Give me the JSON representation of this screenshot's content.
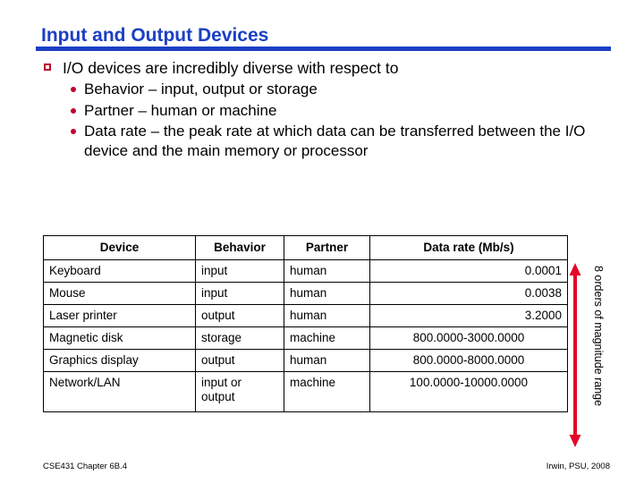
{
  "slide": {
    "title": "Input and Output Devices",
    "accent_color": "#1B3FC4",
    "bullet_color": "#C00030"
  },
  "bullets": {
    "level1": "I/O devices are incredibly diverse with respect to",
    "level2": [
      "Behavior – input, output or storage",
      "Partner – human or machine",
      "Data rate – the peak rate at which data can be transferred between the I/O device and the main memory or processor"
    ]
  },
  "table": {
    "headers": [
      "Device",
      "Behavior",
      "Partner",
      "Data rate (Mb/s)"
    ],
    "rows": [
      {
        "device": "Keyboard",
        "behavior": "input",
        "partner": "human",
        "rate": "0.0001",
        "rate_align": "right"
      },
      {
        "device": "Mouse",
        "behavior": "input",
        "partner": "human",
        "rate": "0.0038",
        "rate_align": "right"
      },
      {
        "device": "Laser printer",
        "behavior": "output",
        "partner": "human",
        "rate": "3.2000",
        "rate_align": "right"
      },
      {
        "device": "Magnetic disk",
        "behavior": "storage",
        "partner": "machine",
        "rate": "800.0000-3000.0000",
        "rate_align": "center"
      },
      {
        "device": "Graphics display",
        "behavior": "output",
        "partner": "human",
        "rate": "800.0000-8000.0000",
        "rate_align": "center"
      },
      {
        "device": "Network/LAN",
        "behavior": "input or output",
        "partner": "machine",
        "rate": "100.0000-10000.0000",
        "rate_align": "center"
      }
    ]
  },
  "annotation": {
    "range_label": "8 orders of magnitude range",
    "arrow_color": "#E3072B"
  },
  "footer": {
    "left": "CSE431 Chapter 6B.4",
    "right": "Irwin, PSU, 2008"
  }
}
